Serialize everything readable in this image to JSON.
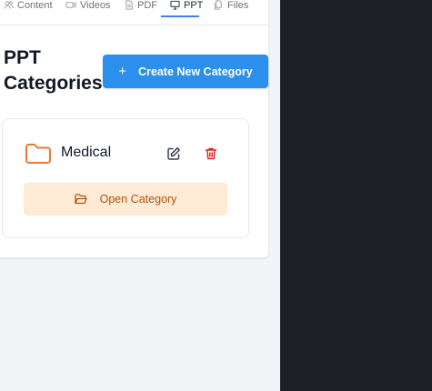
{
  "tabs": [
    {
      "label": "Content",
      "icon": "users-icon"
    },
    {
      "label": "Videos",
      "icon": "video-icon"
    },
    {
      "label": "PDF",
      "icon": "file-text-icon"
    },
    {
      "label": "PPT",
      "icon": "presentation-icon",
      "active": true
    },
    {
      "label": "Files",
      "icon": "files-icon"
    }
  ],
  "section": {
    "title_line1": "PPT",
    "title_line2": "Categories"
  },
  "create_button": {
    "label": "Create New Category",
    "icon": "plus-icon"
  },
  "categories": [
    {
      "name": "Medical",
      "open_label": "Open Category",
      "folder_icon": "folder-icon",
      "edit_icon": "edit-icon",
      "delete_icon": "trash-icon"
    }
  ],
  "colors": {
    "accent_blue": "#2b8fee",
    "folder_orange": "#ea7a32",
    "delete_red": "#dc2626",
    "open_bg": "#fdebd5",
    "open_text": "#b45309",
    "dark_pane": "#1e2028"
  }
}
